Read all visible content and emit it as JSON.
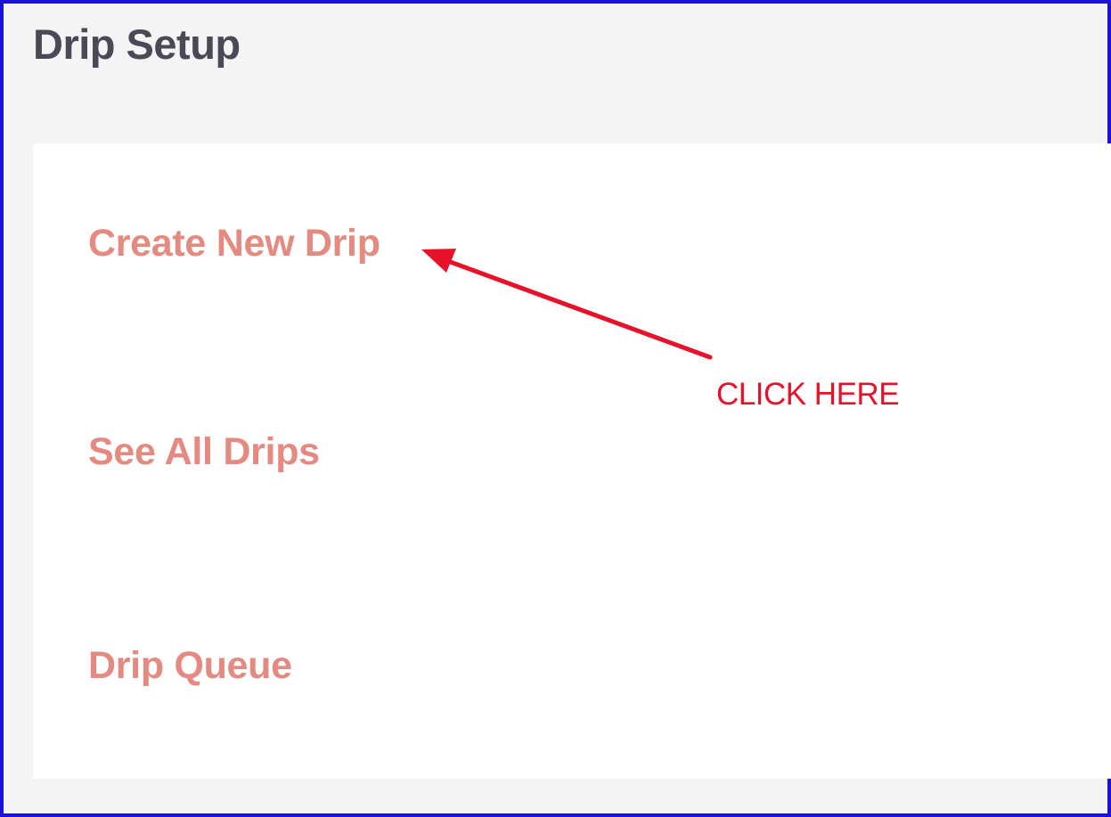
{
  "window": {
    "title": "Drip Setup"
  },
  "menu": {
    "items": [
      {
        "label": "Create New Drip"
      },
      {
        "label": "See All Drips"
      },
      {
        "label": "Drip Queue"
      }
    ]
  },
  "annotation": {
    "text": "CLICK HERE",
    "color": "#e8112a",
    "target": "Create New Drip"
  },
  "colors": {
    "border": "#1a10e0",
    "title": "#4a4a56",
    "link": "#e48a80",
    "background": "#f4f4f5",
    "panel": "#ffffff"
  }
}
